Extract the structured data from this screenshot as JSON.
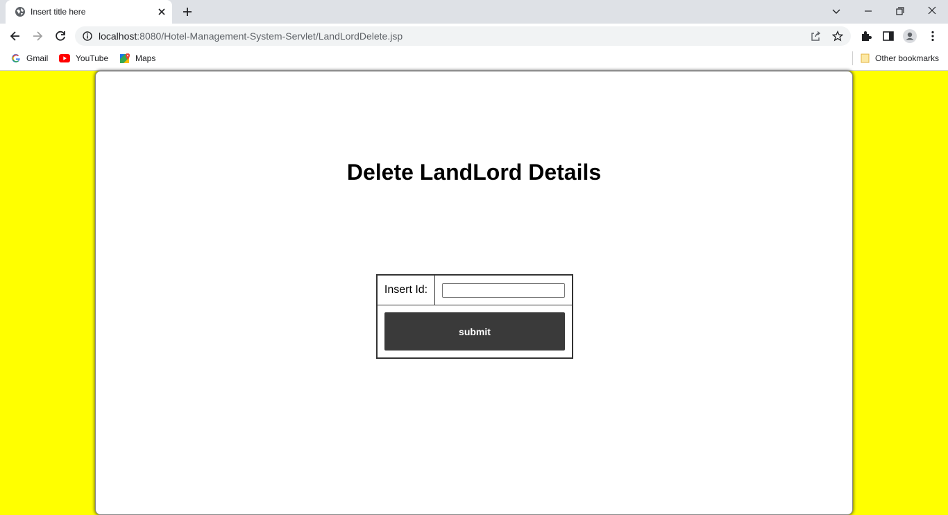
{
  "browser": {
    "tab_title": "Insert title here",
    "url_host": "localhost",
    "url_rest": ":8080/Hotel-Management-System-Servlet/LandLordDelete.jsp",
    "bookmarks": [
      {
        "label": "Gmail",
        "icon": "google-icon"
      },
      {
        "label": "YouTube",
        "icon": "youtube-icon"
      },
      {
        "label": "Maps",
        "icon": "maps-icon"
      }
    ],
    "other_bookmarks": "Other bookmarks"
  },
  "page": {
    "background_color": "#ffff00",
    "title": "Delete LandLord Details",
    "form": {
      "id_label": "Insert Id:",
      "id_value": "",
      "submit_label": "submit"
    }
  }
}
